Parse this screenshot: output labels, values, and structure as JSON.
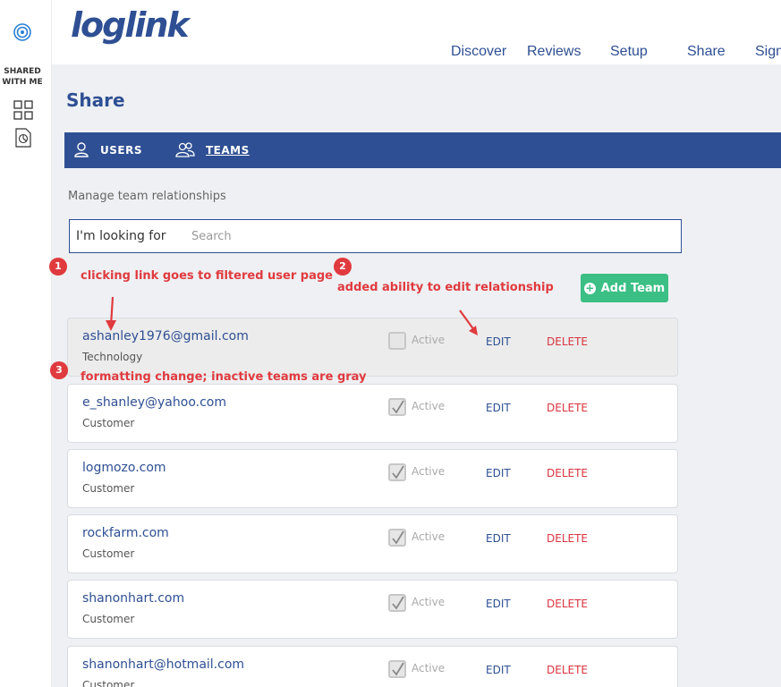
{
  "sidebar": {
    "shared_label": "SHARED WITH ME",
    "icons": [
      "target-icon",
      "grid-icon",
      "report-icon"
    ]
  },
  "header": {
    "logo": "loglink",
    "nav": [
      "Discover",
      "Reviews",
      "Setup",
      "Share",
      "Sign"
    ]
  },
  "page": {
    "title": "Share",
    "subtitle": "Manage team relationships"
  },
  "tabs": {
    "users": "USERS",
    "teams": "TEAMS"
  },
  "search": {
    "label": "I'm looking for",
    "placeholder": "Search",
    "value": ""
  },
  "add_team": "Add Team",
  "teams": [
    {
      "name": "ashanley1976@gmail.com",
      "type": "Technology",
      "active": false,
      "active_label": "Active",
      "edit": "EDIT",
      "delete": "DELETE"
    },
    {
      "name": "e_shanley@yahoo.com",
      "type": "Customer",
      "active": true,
      "active_label": "Active",
      "edit": "EDIT",
      "delete": "DELETE"
    },
    {
      "name": "logmozo.com",
      "type": "Customer",
      "active": true,
      "active_label": "Active",
      "edit": "EDIT",
      "delete": "DELETE"
    },
    {
      "name": "rockfarm.com",
      "type": "Customer",
      "active": true,
      "active_label": "Active",
      "edit": "EDIT",
      "delete": "DELETE"
    },
    {
      "name": "shanonhart.com",
      "type": "Customer",
      "active": true,
      "active_label": "Active",
      "edit": "EDIT",
      "delete": "DELETE"
    },
    {
      "name": "shanonhart@hotmail.com",
      "type": "Customer",
      "active": true,
      "active_label": "Active",
      "edit": "EDIT",
      "delete": "DELETE"
    }
  ],
  "annotations": [
    {
      "num": "1",
      "text": "clicking link goes to filtered user page"
    },
    {
      "num": "2",
      "text": "added ability to edit relationship"
    },
    {
      "num": "3",
      "text": "formatting change; inactive teams are gray"
    }
  ],
  "colors": {
    "brand": "#2e4f93",
    "accent_green": "#3bbf84",
    "delete_red": "#d9333f",
    "annotation_red": "#e03a3e"
  }
}
